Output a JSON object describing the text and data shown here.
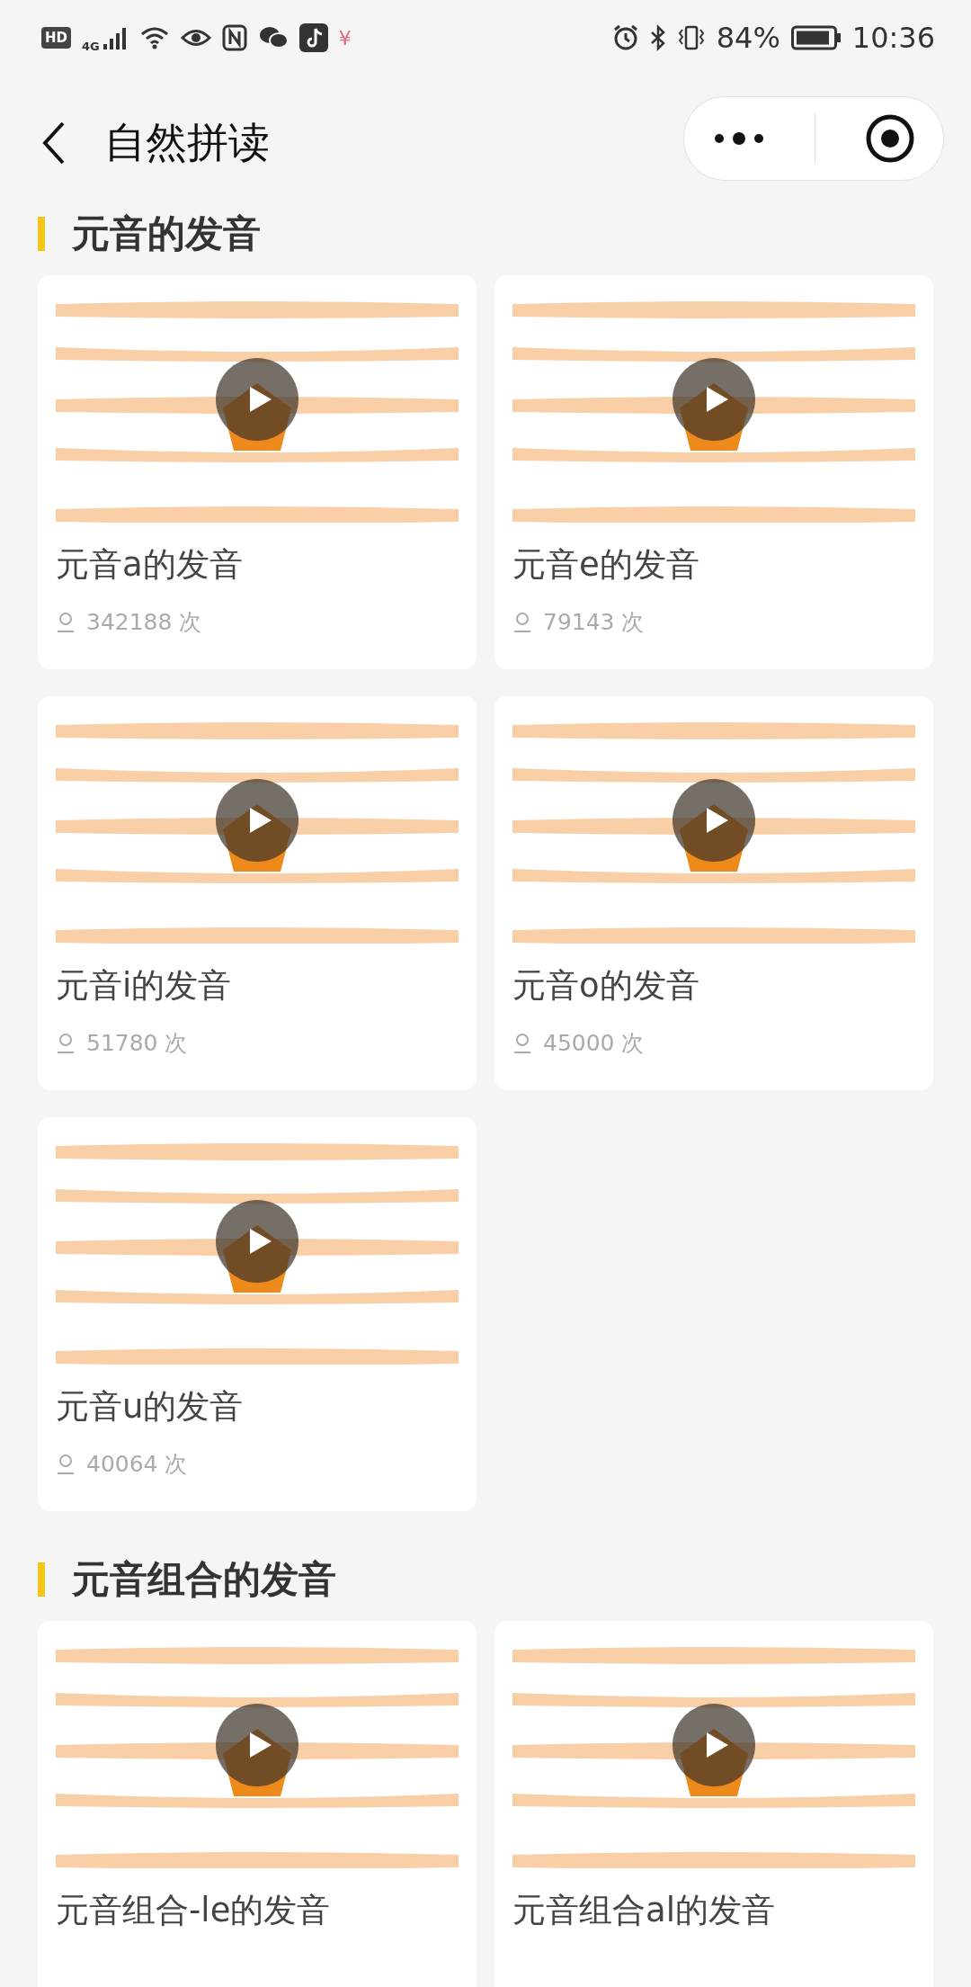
{
  "status_bar": {
    "left": {
      "hd": "HD",
      "network": "4G",
      "currency": "¥"
    },
    "right": {
      "battery": "84%",
      "time": "10:36"
    }
  },
  "header": {
    "title": "自然拼读"
  },
  "sections": [
    {
      "title": "元音的发音",
      "cards": [
        {
          "title": "元音a的发音",
          "views": "342188 次",
          "kind": "picture"
        },
        {
          "title": "元音e的发音",
          "views": "79143 次",
          "kind": "picture"
        },
        {
          "title": "元音i的发音",
          "views": "51780 次",
          "kind": "picture"
        },
        {
          "title": "元音o的发音",
          "views": "45000 次",
          "kind": "picture"
        },
        {
          "title": "元音u的发音",
          "views": "40064 次",
          "kind": "picture"
        }
      ]
    },
    {
      "title": "元音组合的发音",
      "cards": [
        {
          "title": "元音组合-le的发音",
          "kind": "picture"
        },
        {
          "title": "元音组合al的发音",
          "kind": "picture"
        }
      ]
    }
  ]
}
